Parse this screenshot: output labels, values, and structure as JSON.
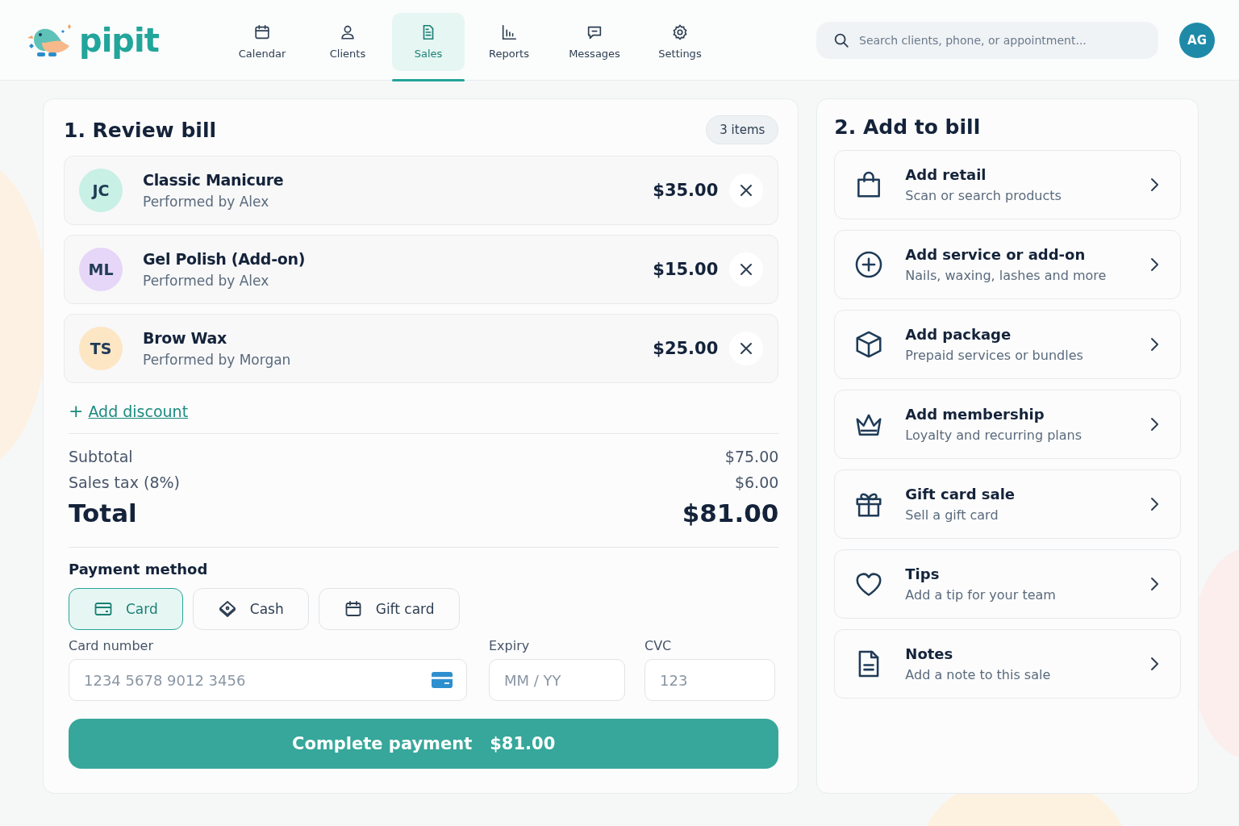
{
  "logo": {
    "text": "pipit"
  },
  "nav": [
    {
      "label": "Calendar",
      "kind": "calendar",
      "selected": false
    },
    {
      "label": "Clients",
      "kind": "person",
      "selected": false
    },
    {
      "label": "Sales",
      "kind": "receipt",
      "selected": true
    },
    {
      "label": "Reports",
      "kind": "chart",
      "selected": false
    },
    {
      "label": "Messages",
      "kind": "message",
      "selected": false
    },
    {
      "label": "Settings",
      "kind": "gear",
      "selected": false
    }
  ],
  "search": {
    "placeholder": "Search clients, phone, or appointment..."
  },
  "user": {
    "initials": "AG"
  },
  "review": {
    "title": "1. Review bill",
    "count": "3 items",
    "items": [
      {
        "initials": "JC",
        "color": "#c8f0e4",
        "name": "Classic Manicure",
        "performer": "Performed by Alex",
        "price": "$35.00"
      },
      {
        "initials": "ML",
        "color": "#e6d6f7",
        "name": "Gel Polish (Add-on)",
        "performer": "Performed by Alex",
        "price": "$15.00"
      },
      {
        "initials": "TS",
        "color": "#fde6c4",
        "name": "Brow Wax",
        "performer": "Performed by Morgan",
        "price": "$25.00"
      }
    ],
    "discount": {
      "icon": "+",
      "label": "Add discount"
    },
    "subtotal": {
      "label": "Subtotal",
      "value": "$75.00"
    },
    "tax": {
      "label": "Sales tax (8%)",
      "value": "$6.00"
    },
    "total": {
      "label": "Total",
      "value": "$81.00"
    },
    "payment": {
      "title": "Payment method",
      "methods": [
        {
          "label": "Card",
          "kind": "card",
          "selected": true
        },
        {
          "label": "Cash",
          "kind": "cash",
          "selected": false
        },
        {
          "label": "Gift card",
          "kind": "calendar",
          "selected": false
        }
      ],
      "card_number": {
        "label": "Card number",
        "placeholder": "1234 5678 9012 3456"
      },
      "expiry": {
        "label": "Expiry",
        "placeholder": "MM / YY"
      },
      "cvc": {
        "label": "CVC",
        "placeholder": "123"
      }
    },
    "submit": {
      "label": "Complete payment",
      "amount": "$81.00"
    }
  },
  "add": {
    "title": "2. Add to bill",
    "items": [
      {
        "kind": "bag",
        "title": "Add retail",
        "subtitle": "Scan or search products"
      },
      {
        "kind": "plus",
        "title": "Add service or add-on",
        "subtitle": "Nails, waxing, lashes and more"
      },
      {
        "kind": "box",
        "title": "Add package",
        "subtitle": "Prepaid services or bundles"
      },
      {
        "kind": "crown",
        "title": "Add membership",
        "subtitle": "Loyalty and recurring plans"
      },
      {
        "kind": "gift",
        "title": "Gift card sale",
        "subtitle": "Sell a gift card"
      },
      {
        "kind": "heart",
        "title": "Tips",
        "subtitle": "Add a tip for your team"
      },
      {
        "kind": "note",
        "title": "Notes",
        "subtitle": "Add a note to this sale"
      }
    ]
  }
}
